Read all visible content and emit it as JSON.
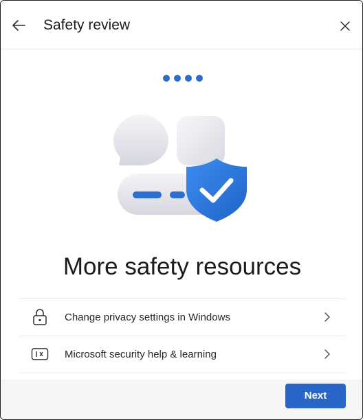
{
  "window": {
    "title": "Safety review",
    "back_icon": "back-arrow-icon",
    "close_icon": "close-icon"
  },
  "progress": {
    "steps": 4,
    "color": "#2b6fd1"
  },
  "main": {
    "heading": "More safety resources",
    "illustration": "shield-checkmark-illustration"
  },
  "resources": [
    {
      "label": "Change privacy settings in Windows",
      "icon": "lock-icon"
    },
    {
      "label": "Microsoft security help & learning",
      "icon": "help-learning-icon"
    }
  ],
  "footer": {
    "next_label": "Next"
  },
  "colors": {
    "accent": "#2966c8",
    "shield": "#2a78e0"
  }
}
